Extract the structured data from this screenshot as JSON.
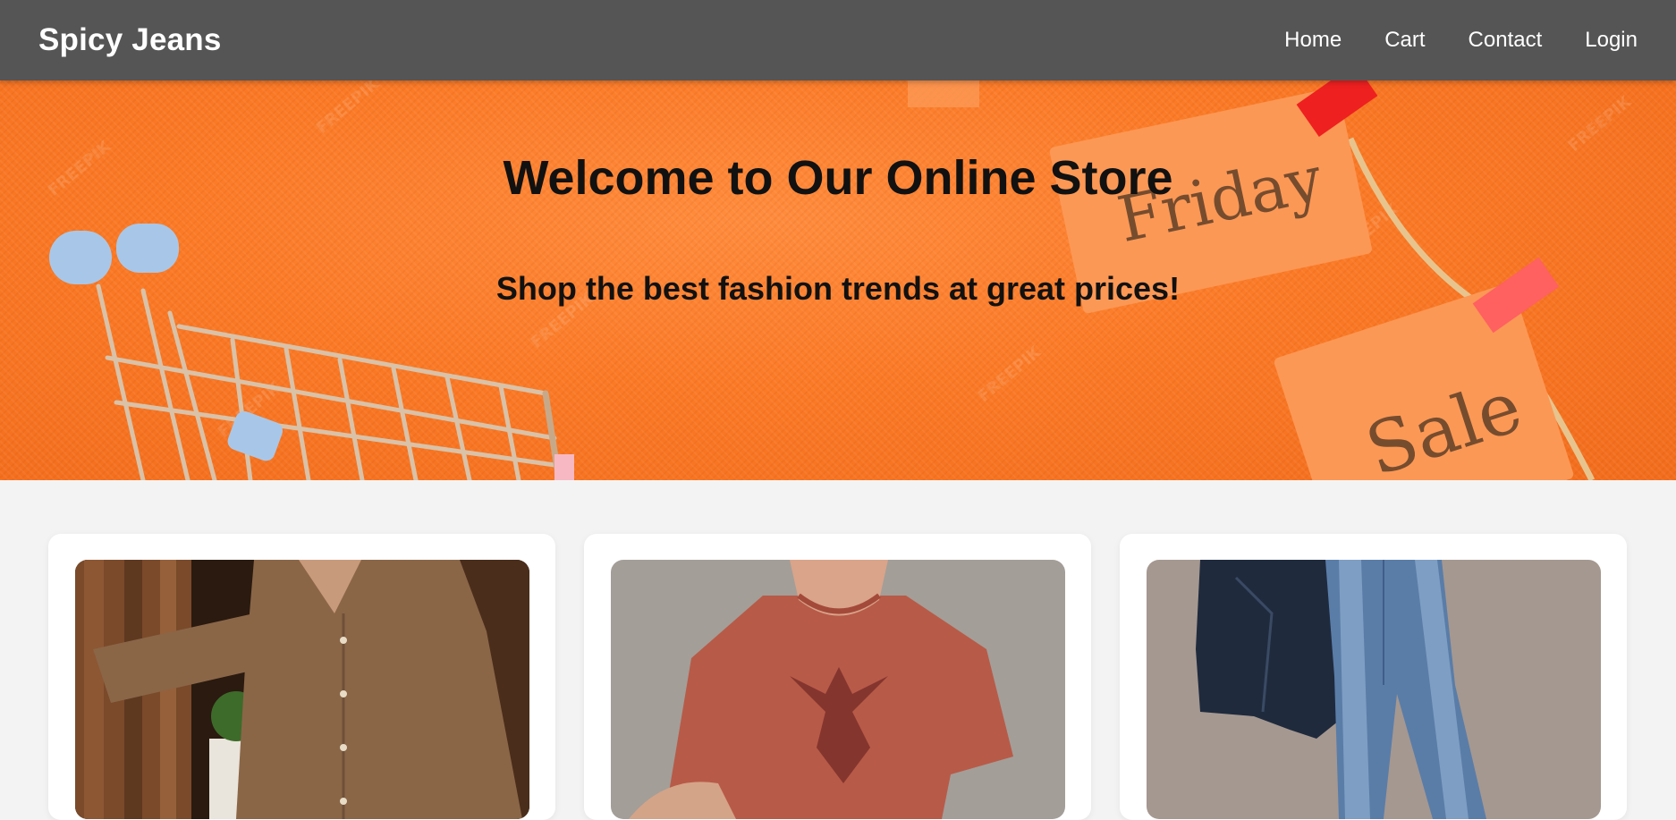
{
  "navbar": {
    "brand": "Spicy Jeans",
    "links": [
      {
        "label": "Home"
      },
      {
        "label": "Cart"
      },
      {
        "label": "Contact"
      },
      {
        "label": "Login"
      }
    ]
  },
  "hero": {
    "title": "Welcome to Our Online Store",
    "subtitle": "Shop the best fashion trends at great prices!",
    "tag_friday": "Friday",
    "tag_sale": "Sale",
    "watermark": "FREEPIK"
  },
  "products": [
    {
      "image": "brown-knit-shirt-photo"
    },
    {
      "image": "red-eagle-tshirt-photo"
    },
    {
      "image": "denim-jacket-jeans-photo"
    }
  ],
  "colors": {
    "navbar": "#555555",
    "hero_orange": "#fb7a26",
    "page_bg": "#f3f3f3"
  }
}
